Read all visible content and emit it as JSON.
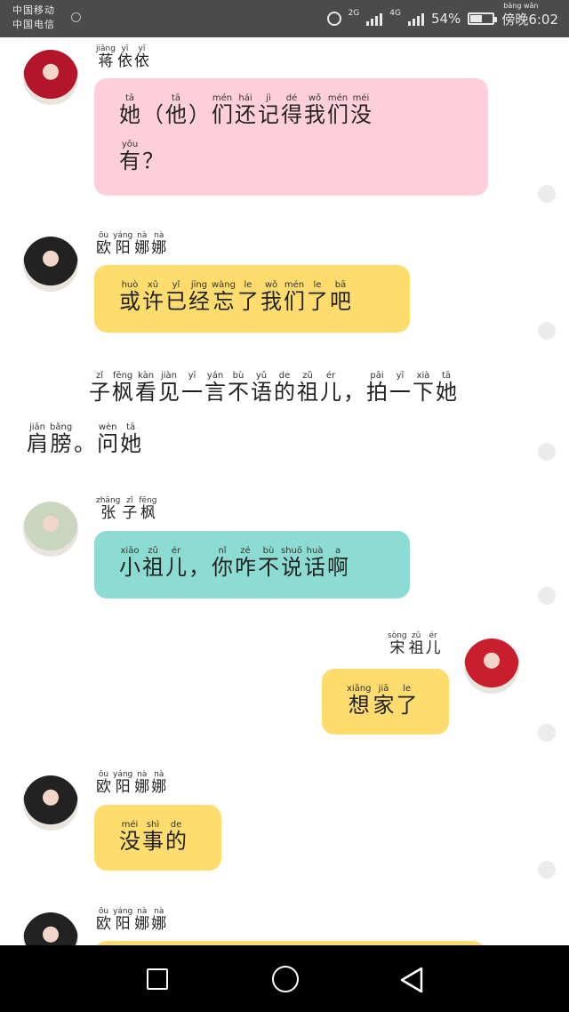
{
  "status_bar": {
    "carrier1": "中国移动",
    "carrier2": "中国电信",
    "net1": "2G",
    "net2": "4G",
    "battery": "54%",
    "time_ruby": "bàng wǎn",
    "time": "傍晚6:02",
    "battery_level": 0.54
  },
  "chat": [
    {
      "type": "left",
      "color": "pink",
      "name": [
        [
          "jiǎng",
          "蒋"
        ],
        [
          "yī",
          "依"
        ],
        [
          "yī",
          "依"
        ]
      ],
      "lines": [
        [
          [
            "tā",
            "她"
          ],
          [
            "",
            "（"
          ],
          [
            "tā",
            "他"
          ],
          [
            "",
            "）"
          ],
          [
            "mén",
            "们"
          ],
          [
            "hái",
            "还"
          ],
          [
            "jì",
            "记"
          ],
          [
            "dé",
            "得"
          ],
          [
            "wǒ",
            "我"
          ],
          [
            "mén",
            "们"
          ],
          [
            "méi",
            "没"
          ]
        ],
        [
          [
            "yǒu",
            "有"
          ],
          [
            "",
            "？"
          ]
        ]
      ]
    },
    {
      "type": "left",
      "color": "yellow",
      "name": [
        [
          "ōu",
          "欧"
        ],
        [
          "yáng",
          "阳"
        ],
        [
          "nà",
          "娜"
        ],
        [
          "nà",
          "娜"
        ]
      ],
      "lines": [
        [
          [
            "huò",
            "或"
          ],
          [
            "xǔ",
            "许"
          ],
          [
            "yǐ",
            "已"
          ],
          [
            "jīng",
            "经"
          ],
          [
            "wàng",
            "忘"
          ],
          [
            "le",
            "了"
          ],
          [
            "wǒ",
            "我"
          ],
          [
            "mén",
            "们"
          ],
          [
            "le",
            "了"
          ],
          [
            "bā",
            "吧"
          ]
        ]
      ]
    },
    {
      "type": "narration",
      "lines": [
        [
          [
            "zǐ",
            "子"
          ],
          [
            "fēng",
            "枫"
          ],
          [
            "kàn",
            "看"
          ],
          [
            "jiàn",
            "见"
          ],
          [
            "yī",
            "一"
          ],
          [
            "yán",
            "言"
          ],
          [
            "bù",
            "不"
          ],
          [
            "yǔ",
            "语"
          ],
          [
            "de",
            "的"
          ],
          [
            "zǔ",
            "祖"
          ],
          [
            "ér",
            "儿"
          ],
          [
            "",
            "，"
          ],
          [
            "pāi",
            "拍"
          ],
          [
            "yī",
            "一"
          ],
          [
            "xià",
            "下"
          ],
          [
            "tā",
            "她"
          ]
        ],
        [
          [
            "jiān",
            "肩"
          ],
          [
            "bǎng",
            "膀"
          ],
          [
            "",
            "。"
          ],
          [
            "wèn",
            "问"
          ],
          [
            "tā",
            "她"
          ]
        ]
      ]
    },
    {
      "type": "left",
      "color": "teal",
      "name": [
        [
          "zhāng",
          "张"
        ],
        [
          "zǐ",
          "子"
        ],
        [
          "fēng",
          "枫"
        ]
      ],
      "lines": [
        [
          [
            "xiǎo",
            "小"
          ],
          [
            "zǔ",
            "祖"
          ],
          [
            "ér",
            "儿"
          ],
          [
            "",
            "，"
          ],
          [
            "nǐ",
            "你"
          ],
          [
            "zé",
            "咋"
          ],
          [
            "bù",
            "不"
          ],
          [
            "shuō",
            "说"
          ],
          [
            "huà",
            "话"
          ],
          [
            "a",
            "啊"
          ]
        ]
      ]
    },
    {
      "type": "right",
      "color": "yellow",
      "name": [
        [
          "sòng",
          "宋"
        ],
        [
          "zǔ",
          "祖"
        ],
        [
          "ér",
          "儿"
        ]
      ],
      "lines": [
        [
          [
            "xiǎng",
            "想"
          ],
          [
            "jiā",
            "家"
          ],
          [
            "le",
            "了"
          ]
        ]
      ]
    },
    {
      "type": "left",
      "color": "yellow",
      "name": [
        [
          "ōu",
          "欧"
        ],
        [
          "yáng",
          "阳"
        ],
        [
          "nà",
          "娜"
        ],
        [
          "nà",
          "娜"
        ]
      ],
      "lines": [
        [
          [
            "méi",
            "没"
          ],
          [
            "shì",
            "事"
          ],
          [
            "de",
            "的"
          ]
        ]
      ]
    },
    {
      "type": "left",
      "color": "yellow",
      "name": [
        [
          "ōu",
          "欧"
        ],
        [
          "yáng",
          "阳"
        ],
        [
          "nà",
          "娜"
        ],
        [
          "nà",
          "娜"
        ]
      ],
      "lines": []
    }
  ]
}
